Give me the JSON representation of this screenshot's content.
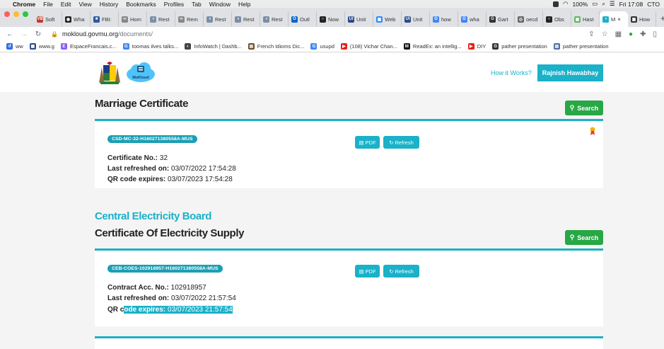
{
  "menubar": {
    "app": "Chrome",
    "items": [
      "File",
      "Edit",
      "View",
      "History",
      "Bookmarks",
      "Profiles",
      "Tab",
      "Window",
      "Help"
    ],
    "battery": "100%",
    "clock": "Fri 17:08",
    "user": "CTO"
  },
  "tabs": [
    {
      "label": "Soft",
      "fav": "VB",
      "color": "#c0392b"
    },
    {
      "label": "Wha",
      "fav": "◉",
      "color": "#222222"
    },
    {
      "label": "FBI:",
      "fav": "■",
      "color": "#2c5aa0"
    },
    {
      "label": "Hom",
      "fav": "∞",
      "color": "#888888"
    },
    {
      "label": "Rest",
      "fav": "◑",
      "color": "#7a8fa6"
    },
    {
      "label": "Rem",
      "fav": "∞",
      "color": "#888888"
    },
    {
      "label": "Rest",
      "fav": "◑",
      "color": "#7a8fa6"
    },
    {
      "label": "Rest",
      "fav": "◑",
      "color": "#7a8fa6"
    },
    {
      "label": "Rest",
      "fav": "◑",
      "color": "#7a8fa6"
    },
    {
      "label": "Outl",
      "fav": "O",
      "color": "#0a64c8"
    },
    {
      "label": "Now",
      "fav": "○",
      "color": "#222222"
    },
    {
      "label": "Unit",
      "fav": "UI",
      "color": "#2c4a8a"
    },
    {
      "label": "Web",
      "fav": "▣",
      "color": "#2d8cff"
    },
    {
      "label": "Unit",
      "fav": "UI",
      "color": "#2c4a8a"
    },
    {
      "label": "how",
      "fav": "G",
      "color": "#4285f4"
    },
    {
      "label": "wha",
      "fav": "G",
      "color": "#4285f4"
    },
    {
      "label": "Gart",
      "fav": "G",
      "color": "#333333"
    },
    {
      "label": "oecd",
      "fav": "◎",
      "color": "#666666"
    },
    {
      "label": "Obs",
      "fav": "○",
      "color": "#222222"
    },
    {
      "label": "Hast",
      "fav": "▣",
      "color": "#5cb85c"
    },
    {
      "label": "M",
      "fav": "◑",
      "color": "#1ab1c9",
      "active": true
    },
    {
      "label": "How",
      "fav": "▣",
      "color": "#333333"
    }
  ],
  "address": {
    "host": "mokloud.govmu.org",
    "path": "/documents/"
  },
  "bookmarks": [
    {
      "label": "ww",
      "fav": "↺",
      "color": "#2d6cdf"
    },
    {
      "label": "www.g",
      "fav": "▦",
      "color": "#2c4a8a"
    },
    {
      "label": "EspaceFrancais.c...",
      "fav": "E",
      "color": "#8b5cf6"
    },
    {
      "label": "toomas ilves talks...",
      "fav": "G",
      "color": "#4285f4"
    },
    {
      "label": "InfoWatch | Dashb...",
      "fav": "◐",
      "color": "#444444"
    },
    {
      "label": "French Idioms Dic...",
      "fav": "▤",
      "color": "#6b4f2a"
    },
    {
      "label": "usupd",
      "fav": "G",
      "color": "#4285f4"
    },
    {
      "label": "(108) Vichar Chan...",
      "fav": "▶",
      "color": "#e62117"
    },
    {
      "label": "ReadEx: an intellig...",
      "fav": "M",
      "color": "#111111"
    },
    {
      "label": "DIY",
      "fav": "▶",
      "color": "#e62117"
    },
    {
      "label": "pather presentation",
      "fav": "G",
      "color": "#333333"
    },
    {
      "label": "pather presentation",
      "fav": "▤",
      "color": "#4a6fa5"
    }
  ],
  "header": {
    "how_link": "How it Works?",
    "user_name": "Rajnish Hawabhay",
    "cloud_label": "MoKloud"
  },
  "sections": [
    {
      "org": "",
      "title": "Marriage Certificate",
      "search_label": "Search",
      "badge": "CSD-MC-32-H160271380558A-MUS",
      "pdf_label": "PDF",
      "refresh_label": "Refresh",
      "fields": [
        {
          "key": "Certificate No.:",
          "value": "32"
        },
        {
          "key": "Last refreshed on:",
          "value": "03/07/2022 17:54:28"
        },
        {
          "key": "QR code expires:",
          "value": "03/07/2023 17:54:28"
        }
      ]
    },
    {
      "org": "Central Electricity Board",
      "title": "Certificate Of Electricity Supply",
      "search_label": "Search",
      "badge": "CEB-COES-102918957-H160271380558A-MUS",
      "pdf_label": "PDF",
      "refresh_label": "Refresh",
      "fields": [
        {
          "key": "Contract Acc. No.:",
          "value": "102918957"
        },
        {
          "key": "Last refreshed on:",
          "value": "03/07/2022 21:57:54"
        },
        {
          "key_plain": "QR c",
          "key_hl": "ode expires:",
          "value": "03/07/2023 21:57:54"
        }
      ]
    }
  ]
}
